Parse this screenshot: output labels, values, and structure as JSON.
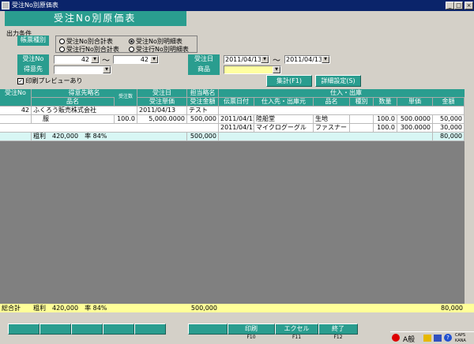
{
  "window": {
    "title": "受注No別原価表"
  },
  "header": {
    "title": "受注No別原価表"
  },
  "conditions": {
    "section_label": "出力条件",
    "report_type_label": "帳票種別",
    "report_types": [
      "受注No別合計表",
      "受注No別明細表",
      "受注行No別合計表",
      "受注行No別明細表"
    ],
    "order_no_label": "受注No",
    "order_no_from": "42",
    "order_no_to": "42",
    "range_sep": "〜",
    "customer_label": "得意先",
    "order_date_label": "受注日",
    "order_date_from": "2011/04/13",
    "order_date_to": "2011/04/13",
    "product_label": "商品",
    "print_preview_label": "印刷プレビューあり",
    "tally_button": "集計(F1)",
    "detail_button": "詳細設定(S)"
  },
  "grid": {
    "h1": [
      "受注No",
      "得意先略名",
      "受注日",
      "担当略名",
      "仕入・出庫"
    ],
    "h2": [
      "品名",
      "受注数",
      "受注単価",
      "受注金額",
      "伝票日付",
      "仕入先・出庫元",
      "品名",
      "種別",
      "数量",
      "単価",
      "金額"
    ],
    "row1": {
      "no": "42",
      "customer": "ふくろう販売株式会社",
      "date": "2011/04/13",
      "staff": "テスト"
    },
    "row2": {
      "item": "服",
      "qty": "100.0",
      "price": "5,000.0000",
      "amount": "500,000",
      "sdate": "2011/04/15",
      "supplier": "陸船堂",
      "sitem": "生地",
      "sqty": "100.0",
      "sprice": "500.0000",
      "samount": "50,000"
    },
    "row3": {
      "sdate": "2011/04/15",
      "supplier": "マイクログーグル",
      "sitem": "ファスナー",
      "sqty": "100.0",
      "sprice": "300.0000",
      "samount": "30,000"
    },
    "subtotal": {
      "label": "粗利　420,000　率 84%",
      "amount": "500,000",
      "samount": "80,000"
    }
  },
  "total": {
    "label": "総合計",
    "text": "粗利　420,000　率 84%",
    "amount": "500,000",
    "samount": "80,000"
  },
  "fkeys": [
    {
      "label": "印刷",
      "key": "F10"
    },
    {
      "label": "エクセル",
      "key": "F11"
    },
    {
      "label": "終了",
      "key": "F12"
    }
  ],
  "status": {
    "ime": "A般",
    "caps": "CAPS",
    "kana": "KANA"
  }
}
